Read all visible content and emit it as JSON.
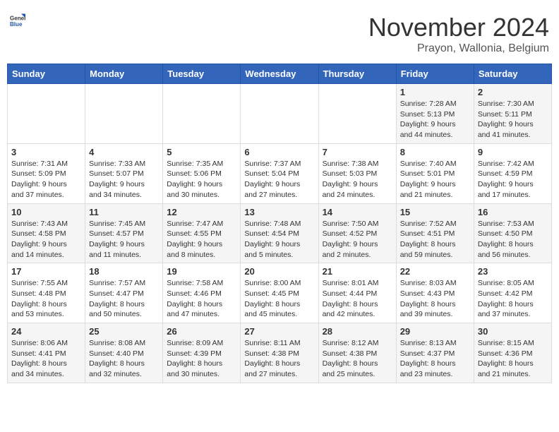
{
  "header": {
    "logo_general": "General",
    "logo_blue": "Blue",
    "month_title": "November 2024",
    "location": "Prayon, Wallonia, Belgium"
  },
  "weekdays": [
    "Sunday",
    "Monday",
    "Tuesday",
    "Wednesday",
    "Thursday",
    "Friday",
    "Saturday"
  ],
  "weeks": [
    [
      {
        "day": "",
        "info": ""
      },
      {
        "day": "",
        "info": ""
      },
      {
        "day": "",
        "info": ""
      },
      {
        "day": "",
        "info": ""
      },
      {
        "day": "",
        "info": ""
      },
      {
        "day": "1",
        "info": "Sunrise: 7:28 AM\nSunset: 5:13 PM\nDaylight: 9 hours and 44 minutes."
      },
      {
        "day": "2",
        "info": "Sunrise: 7:30 AM\nSunset: 5:11 PM\nDaylight: 9 hours and 41 minutes."
      }
    ],
    [
      {
        "day": "3",
        "info": "Sunrise: 7:31 AM\nSunset: 5:09 PM\nDaylight: 9 hours and 37 minutes."
      },
      {
        "day": "4",
        "info": "Sunrise: 7:33 AM\nSunset: 5:07 PM\nDaylight: 9 hours and 34 minutes."
      },
      {
        "day": "5",
        "info": "Sunrise: 7:35 AM\nSunset: 5:06 PM\nDaylight: 9 hours and 30 minutes."
      },
      {
        "day": "6",
        "info": "Sunrise: 7:37 AM\nSunset: 5:04 PM\nDaylight: 9 hours and 27 minutes."
      },
      {
        "day": "7",
        "info": "Sunrise: 7:38 AM\nSunset: 5:03 PM\nDaylight: 9 hours and 24 minutes."
      },
      {
        "day": "8",
        "info": "Sunrise: 7:40 AM\nSunset: 5:01 PM\nDaylight: 9 hours and 21 minutes."
      },
      {
        "day": "9",
        "info": "Sunrise: 7:42 AM\nSunset: 4:59 PM\nDaylight: 9 hours and 17 minutes."
      }
    ],
    [
      {
        "day": "10",
        "info": "Sunrise: 7:43 AM\nSunset: 4:58 PM\nDaylight: 9 hours and 14 minutes."
      },
      {
        "day": "11",
        "info": "Sunrise: 7:45 AM\nSunset: 4:57 PM\nDaylight: 9 hours and 11 minutes."
      },
      {
        "day": "12",
        "info": "Sunrise: 7:47 AM\nSunset: 4:55 PM\nDaylight: 9 hours and 8 minutes."
      },
      {
        "day": "13",
        "info": "Sunrise: 7:48 AM\nSunset: 4:54 PM\nDaylight: 9 hours and 5 minutes."
      },
      {
        "day": "14",
        "info": "Sunrise: 7:50 AM\nSunset: 4:52 PM\nDaylight: 9 hours and 2 minutes."
      },
      {
        "day": "15",
        "info": "Sunrise: 7:52 AM\nSunset: 4:51 PM\nDaylight: 8 hours and 59 minutes."
      },
      {
        "day": "16",
        "info": "Sunrise: 7:53 AM\nSunset: 4:50 PM\nDaylight: 8 hours and 56 minutes."
      }
    ],
    [
      {
        "day": "17",
        "info": "Sunrise: 7:55 AM\nSunset: 4:48 PM\nDaylight: 8 hours and 53 minutes."
      },
      {
        "day": "18",
        "info": "Sunrise: 7:57 AM\nSunset: 4:47 PM\nDaylight: 8 hours and 50 minutes."
      },
      {
        "day": "19",
        "info": "Sunrise: 7:58 AM\nSunset: 4:46 PM\nDaylight: 8 hours and 47 minutes."
      },
      {
        "day": "20",
        "info": "Sunrise: 8:00 AM\nSunset: 4:45 PM\nDaylight: 8 hours and 45 minutes."
      },
      {
        "day": "21",
        "info": "Sunrise: 8:01 AM\nSunset: 4:44 PM\nDaylight: 8 hours and 42 minutes."
      },
      {
        "day": "22",
        "info": "Sunrise: 8:03 AM\nSunset: 4:43 PM\nDaylight: 8 hours and 39 minutes."
      },
      {
        "day": "23",
        "info": "Sunrise: 8:05 AM\nSunset: 4:42 PM\nDaylight: 8 hours and 37 minutes."
      }
    ],
    [
      {
        "day": "24",
        "info": "Sunrise: 8:06 AM\nSunset: 4:41 PM\nDaylight: 8 hours and 34 minutes."
      },
      {
        "day": "25",
        "info": "Sunrise: 8:08 AM\nSunset: 4:40 PM\nDaylight: 8 hours and 32 minutes."
      },
      {
        "day": "26",
        "info": "Sunrise: 8:09 AM\nSunset: 4:39 PM\nDaylight: 8 hours and 30 minutes."
      },
      {
        "day": "27",
        "info": "Sunrise: 8:11 AM\nSunset: 4:38 PM\nDaylight: 8 hours and 27 minutes."
      },
      {
        "day": "28",
        "info": "Sunrise: 8:12 AM\nSunset: 4:38 PM\nDaylight: 8 hours and 25 minutes."
      },
      {
        "day": "29",
        "info": "Sunrise: 8:13 AM\nSunset: 4:37 PM\nDaylight: 8 hours and 23 minutes."
      },
      {
        "day": "30",
        "info": "Sunrise: 8:15 AM\nSunset: 4:36 PM\nDaylight: 8 hours and 21 minutes."
      }
    ]
  ]
}
